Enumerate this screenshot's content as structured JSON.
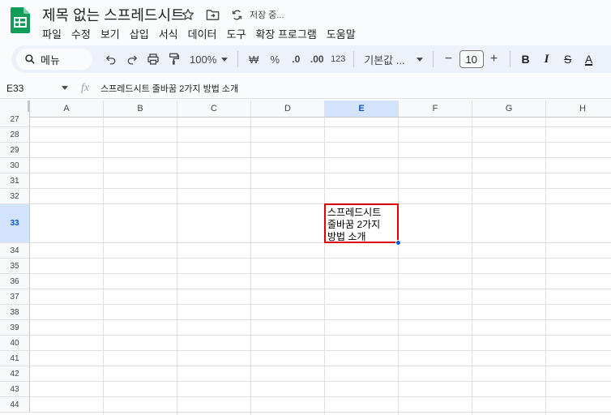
{
  "app": {
    "title": "제목 없는 스프레드시트",
    "save_status": "저장 중...",
    "brand_color": "#0f9d58"
  },
  "menu": [
    "파일",
    "수정",
    "보기",
    "삽입",
    "서식",
    "데이터",
    "도구",
    "확장 프로그램",
    "도움말"
  ],
  "toolbar": {
    "search_label": "메뉴",
    "zoom": "100%",
    "currency": "₩",
    "percent": "%",
    "dec_decrease": ".0",
    "dec_increase": ".00",
    "number_format": "123",
    "font": "기본값 ...",
    "font_size": "10",
    "minus": "−",
    "plus": "+",
    "bold": "B",
    "italic": "I",
    "strike": "S",
    "text_color": "A"
  },
  "formula_bar": {
    "cell_ref": "E33",
    "fx": "fx",
    "content": "스프레드시트 줄바꿈 2가지 방법 소개"
  },
  "grid": {
    "columns": [
      "A",
      "B",
      "C",
      "D",
      "E",
      "F",
      "G",
      "H"
    ],
    "active_column": "E",
    "rows": [
      "27",
      "28",
      "29",
      "30",
      "31",
      "32",
      "33",
      "34",
      "35",
      "36",
      "37",
      "38",
      "39",
      "40",
      "41",
      "42",
      "43",
      "44"
    ],
    "active_row": "33",
    "active_cell_text": "스프레드시트\n줄바꿈 2가지\n방법 소개"
  }
}
